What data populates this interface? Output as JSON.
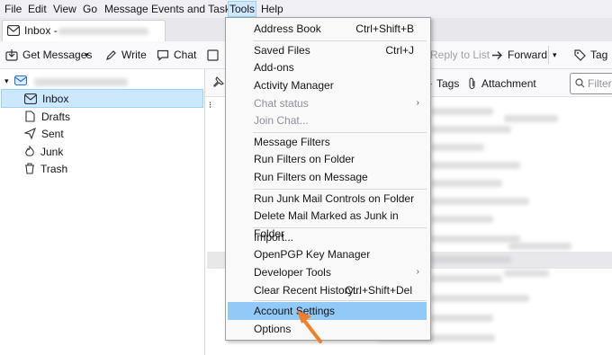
{
  "menubar": {
    "items": [
      "File",
      "Edit",
      "View",
      "Go",
      "Message",
      "Events and Tasks",
      "Tools",
      "Help"
    ]
  },
  "tab": {
    "label": "Inbox - "
  },
  "toolbar": {
    "get_messages": "Get Messages",
    "write": "Write",
    "chat": "Chat",
    "reply_to_list": "Reply to List",
    "forward": "Forward",
    "tag": "Tag"
  },
  "quickfilter": {
    "tags": "Tags",
    "attachment": "Attachment",
    "filter_placeholder": "Filter"
  },
  "folders": [
    "Inbox",
    "Drafts",
    "Sent",
    "Junk",
    "Trash"
  ],
  "tools_menu": {
    "items": [
      {
        "label": "Address Book",
        "shortcut": "Ctrl+Shift+B"
      },
      {
        "label": "Saved Files",
        "shortcut": "Ctrl+J"
      },
      {
        "label": "Add-ons",
        "shortcut": ""
      },
      {
        "label": "Activity Manager",
        "shortcut": ""
      },
      {
        "label": "Chat status",
        "shortcut": ""
      },
      {
        "label": "Join Chat...",
        "shortcut": ""
      },
      {
        "label": "Message Filters",
        "shortcut": ""
      },
      {
        "label": "Run Filters on Folder",
        "shortcut": ""
      },
      {
        "label": "Run Filters on Message",
        "shortcut": ""
      },
      {
        "label": "Run Junk Mail Controls on Folder",
        "shortcut": ""
      },
      {
        "label": "Delete Mail Marked as Junk in Folder",
        "shortcut": ""
      },
      {
        "label": "Import...",
        "shortcut": ""
      },
      {
        "label": "OpenPGP Key Manager",
        "shortcut": ""
      },
      {
        "label": "Developer Tools",
        "shortcut": ""
      },
      {
        "label": "Clear Recent History...",
        "shortcut": "Ctrl+Shift+Del"
      },
      {
        "label": "Account Settings",
        "shortcut": ""
      },
      {
        "label": "Options",
        "shortcut": ""
      }
    ]
  },
  "colors": {
    "highlight": "#91c9f7",
    "selected_folder": "#cce8ff",
    "pointer_arrow": "#f07f2a"
  }
}
